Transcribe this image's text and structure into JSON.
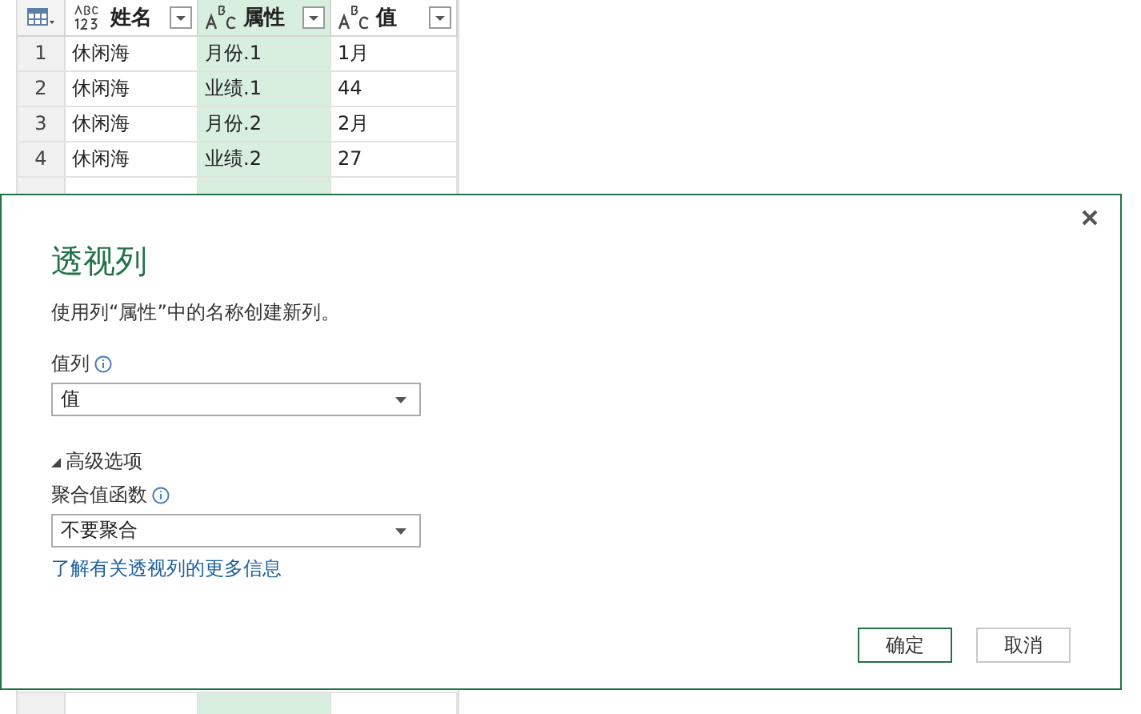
{
  "table": {
    "columns": [
      {
        "label": "姓名",
        "kind": "any",
        "selected": false
      },
      {
        "label": "属性",
        "kind": "text",
        "selected": true
      },
      {
        "label": "值",
        "kind": "text",
        "selected": false
      }
    ],
    "rows": [
      {
        "num": "1",
        "cells": [
          "休闲海",
          "月份.1",
          "1月"
        ]
      },
      {
        "num": "2",
        "cells": [
          "休闲海",
          "业绩.1",
          "44"
        ]
      },
      {
        "num": "3",
        "cells": [
          "休闲海",
          "月份.2",
          "2月"
        ]
      },
      {
        "num": "4",
        "cells": [
          "休闲海",
          "业绩.2",
          "27"
        ]
      }
    ]
  },
  "dialog": {
    "title": "透视列",
    "description": "使用列“属性”中的名称创建新列。",
    "value_column": {
      "label": "值列",
      "value": "值"
    },
    "advanced": {
      "label": "高级选项",
      "expanded": true
    },
    "aggregate": {
      "label": "聚合值函数",
      "value": "不要聚合"
    },
    "link": "了解有关透视列的更多信息",
    "buttons": [
      {
        "label": "确定",
        "primary": true
      },
      {
        "label": "取消",
        "primary": false
      }
    ]
  }
}
